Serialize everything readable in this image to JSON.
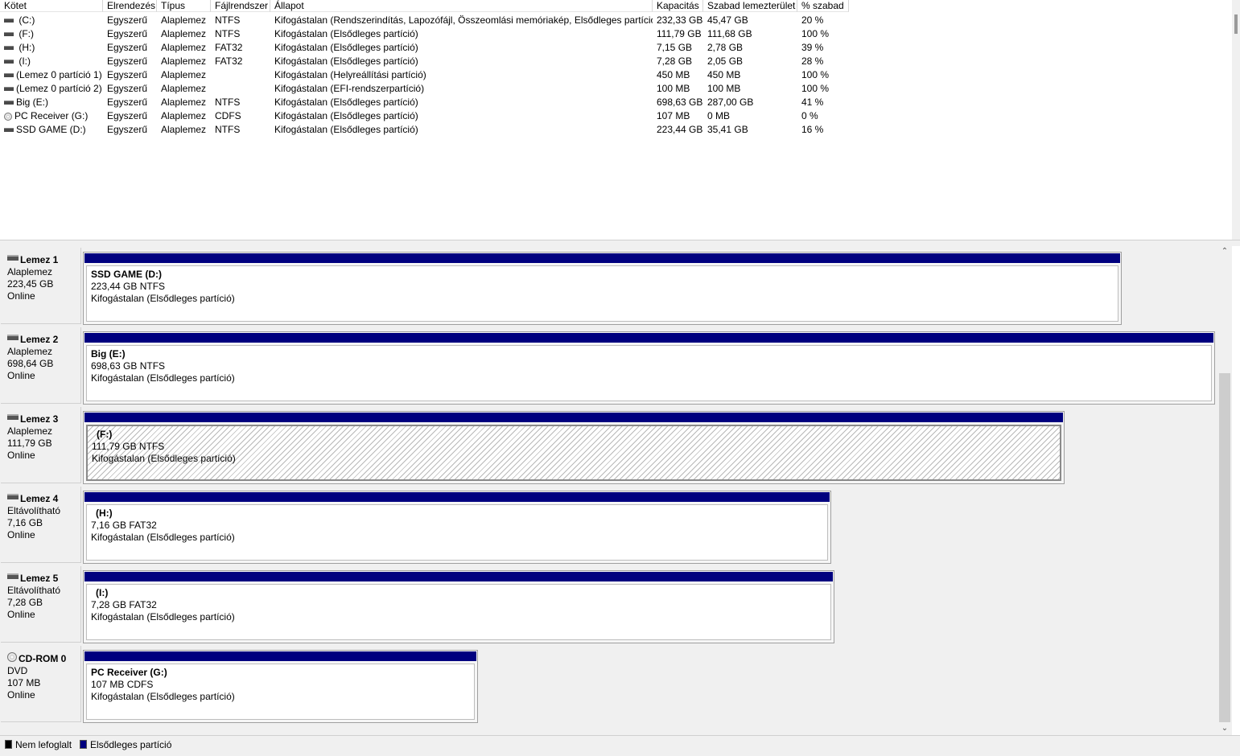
{
  "columns": [
    "Kötet",
    "Elrendezés",
    "Típus",
    "Fájlrendszer",
    "Állapot",
    "Kapacitás",
    "Szabad lemezterület",
    "% szabad"
  ],
  "volumes": [
    {
      "icon": "drive-icon",
      "name": " (C:)",
      "layout": "Egyszerű",
      "type": "Alaplemez",
      "fs": "NTFS",
      "status": "Kifogástalan (Rendszerindítás, Lapozófájl, Összeomlási memóriakép, Elsődleges partíció)",
      "capacity": "232,33 GB",
      "free": "45,47 GB",
      "pct": "20 %"
    },
    {
      "icon": "drive-icon",
      "name": " (F:)",
      "layout": "Egyszerű",
      "type": "Alaplemez",
      "fs": "NTFS",
      "status": "Kifogástalan (Elsődleges partíció)",
      "capacity": "111,79 GB",
      "free": "111,68 GB",
      "pct": "100 %"
    },
    {
      "icon": "drive-icon",
      "name": " (H:)",
      "layout": "Egyszerű",
      "type": "Alaplemez",
      "fs": "FAT32",
      "status": "Kifogástalan (Elsődleges partíció)",
      "capacity": "7,15 GB",
      "free": "2,78 GB",
      "pct": "39 %"
    },
    {
      "icon": "drive-icon",
      "name": " (I:)",
      "layout": "Egyszerű",
      "type": "Alaplemez",
      "fs": "FAT32",
      "status": "Kifogástalan (Elsődleges partíció)",
      "capacity": "7,28 GB",
      "free": "2,05 GB",
      "pct": "28 %"
    },
    {
      "icon": "drive-icon",
      "name": "(Lemez 0 partíció 1)",
      "layout": "Egyszerű",
      "type": "Alaplemez",
      "fs": "",
      "status": "Kifogástalan (Helyreállítási partíció)",
      "capacity": "450 MB",
      "free": "450 MB",
      "pct": "100 %"
    },
    {
      "icon": "drive-icon",
      "name": "(Lemez 0 partíció 2)",
      "layout": "Egyszerű",
      "type": "Alaplemez",
      "fs": "",
      "status": "Kifogástalan (EFI-rendszerpartíció)",
      "capacity": "100 MB",
      "free": "100 MB",
      "pct": "100 %"
    },
    {
      "icon": "drive-icon",
      "name": "Big (E:)",
      "layout": "Egyszerű",
      "type": "Alaplemez",
      "fs": "NTFS",
      "status": "Kifogástalan (Elsődleges partíció)",
      "capacity": "698,63 GB",
      "free": "287,00 GB",
      "pct": "41 %"
    },
    {
      "icon": "cd-icon",
      "name": "PC Receiver (G:)",
      "layout": "Egyszerű",
      "type": "Alaplemez",
      "fs": "CDFS",
      "status": "Kifogástalan (Elsődleges partíció)",
      "capacity": "107 MB",
      "free": "0 MB",
      "pct": "0 %"
    },
    {
      "icon": "drive-icon",
      "name": "SSD GAME (D:)",
      "layout": "Egyszerű",
      "type": "Alaplemez",
      "fs": "NTFS",
      "status": "Kifogástalan (Elsődleges partíció)",
      "capacity": "223,44 GB",
      "free": "35,41 GB",
      "pct": "16 %"
    }
  ],
  "disks": [
    {
      "icon": "drive-icon",
      "name": "Lemez 1",
      "type": "Alaplemez",
      "size": "223,45 GB",
      "state": "Online",
      "partition": {
        "title": "SSD GAME  (D:)",
        "detail": "223,44 GB NTFS",
        "status": "Kifogástalan (Elsődleges partíció)",
        "selected": false
      }
    },
    {
      "icon": "drive-icon",
      "name": "Lemez 2",
      "type": "Alaplemez",
      "size": "698,64 GB",
      "state": "Online",
      "partition": {
        "title": "Big  (E:)",
        "detail": "698,63 GB NTFS",
        "status": "Kifogástalan (Elsődleges partíció)",
        "selected": false
      }
    },
    {
      "icon": "drive-icon",
      "name": "Lemez 3",
      "type": "Alaplemez",
      "size": "111,79 GB",
      "state": "Online",
      "partition": {
        "title": "(F:)",
        "detail": "111,79 GB NTFS",
        "status": "Kifogástalan (Elsődleges partíció)",
        "selected": true
      }
    },
    {
      "icon": "drive-icon",
      "name": "Lemez 4",
      "type": "Eltávolítható",
      "size": "7,16 GB",
      "state": "Online",
      "partition": {
        "title": "(H:)",
        "detail": "7,16 GB FAT32",
        "status": "Kifogástalan (Elsődleges partíció)",
        "selected": false
      }
    },
    {
      "icon": "drive-icon",
      "name": "Lemez 5",
      "type": "Eltávolítható",
      "size": "7,28 GB",
      "state": "Online",
      "partition": {
        "title": "(I:)",
        "detail": "7,28 GB FAT32",
        "status": "Kifogástalan (Elsődleges partíció)",
        "selected": false
      }
    },
    {
      "icon": "cd-icon",
      "name": "CD-ROM 0",
      "type": "DVD",
      "size": "107 MB",
      "state": "Online",
      "partition": {
        "title": "PC Receiver  (G:)",
        "detail": "107 MB CDFS",
        "status": "Kifogástalan (Elsődleges partíció)",
        "selected": false
      }
    }
  ],
  "legend": [
    {
      "label": "Nem lefoglalt",
      "color": "#000000"
    },
    {
      "label": "Elsődleges partíció",
      "color": "#00007f"
    }
  ]
}
